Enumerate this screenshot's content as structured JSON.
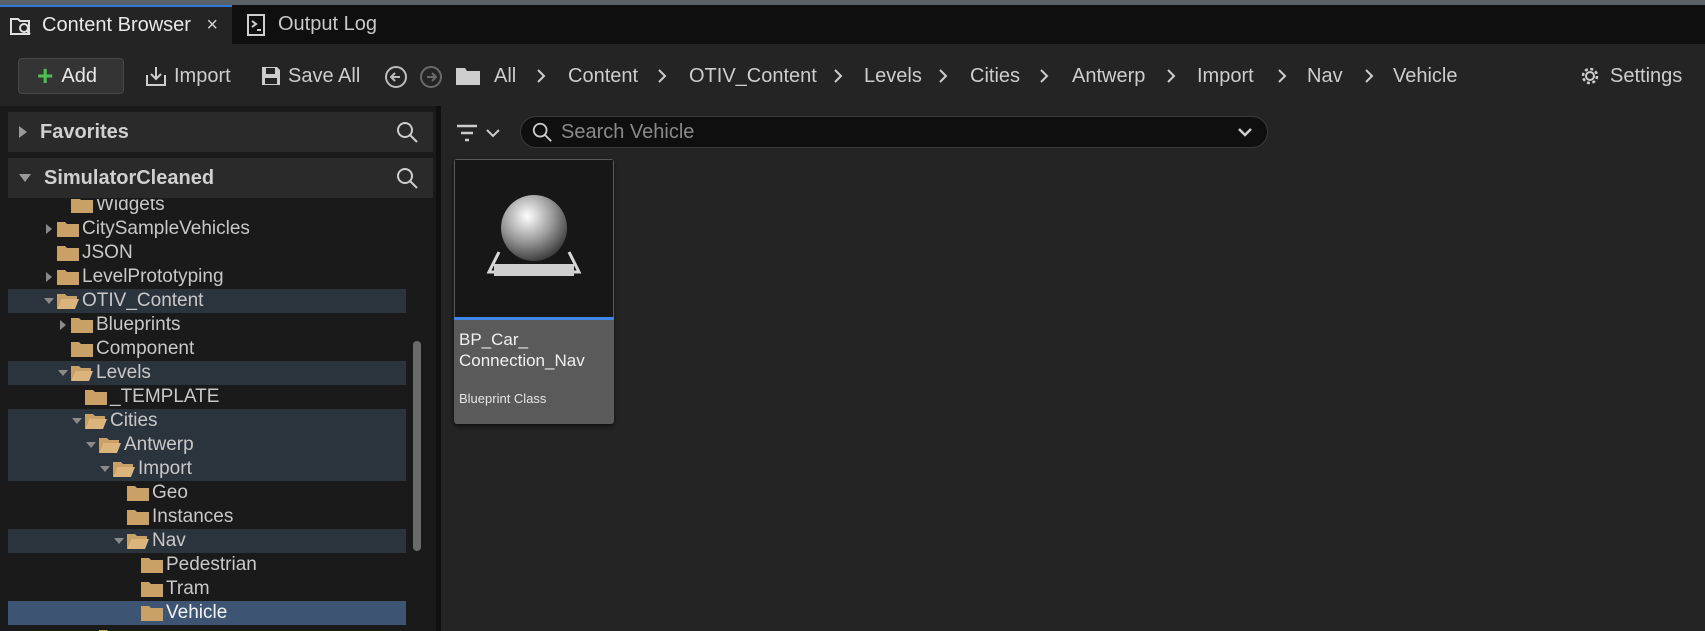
{
  "tabs": [
    {
      "label": "Content Browser",
      "icon": "content-browser-icon",
      "close": "×"
    },
    {
      "label": "Output Log",
      "icon": "output-log-icon"
    }
  ],
  "toolbar": {
    "add_label": "Add",
    "import_label": "Import",
    "save_all_label": "Save All",
    "breadcrumbs": [
      "All",
      "Content",
      "OTIV_Content",
      "Levels",
      "Cities",
      "Antwerp",
      "Import",
      "Nav",
      "Vehicle"
    ],
    "settings_label": "Settings"
  },
  "sources": {
    "favorites_label": "Favorites",
    "project_label": "SimulatorCleaned"
  },
  "tree": [
    {
      "label": "Widgets",
      "state": "none"
    },
    {
      "label": "CitySampleVehicles",
      "state": "collapsed"
    },
    {
      "label": "JSON",
      "state": "none"
    },
    {
      "label": "LevelPrototyping",
      "state": "collapsed"
    },
    {
      "label": "OTIV_Content",
      "state": "expanded"
    },
    {
      "label": "Blueprints",
      "state": "collapsed"
    },
    {
      "label": "Component",
      "state": "none"
    },
    {
      "label": "Levels",
      "state": "expanded"
    },
    {
      "label": "_TEMPLATE",
      "state": "none"
    },
    {
      "label": "Cities",
      "state": "expanded"
    },
    {
      "label": "Antwerp",
      "state": "expanded"
    },
    {
      "label": "Import",
      "state": "expanded"
    },
    {
      "label": "Geo",
      "state": "none"
    },
    {
      "label": "Instances",
      "state": "none"
    },
    {
      "label": "Nav",
      "state": "expanded"
    },
    {
      "label": "Pedestrian",
      "state": "none"
    },
    {
      "label": "Tram",
      "state": "none"
    },
    {
      "label": "Vehicle",
      "state": "none"
    }
  ],
  "search": {
    "placeholder": "Search Vehicle",
    "value": ""
  },
  "assets": [
    {
      "name": "BP_Car_ Connection_Nav",
      "type": "Blueprint Class"
    }
  ],
  "colors": {
    "accent": "#3f86e6",
    "add_plus": "#4fc04f",
    "folder": "#c9a066",
    "selected_row": "#3d5572"
  }
}
